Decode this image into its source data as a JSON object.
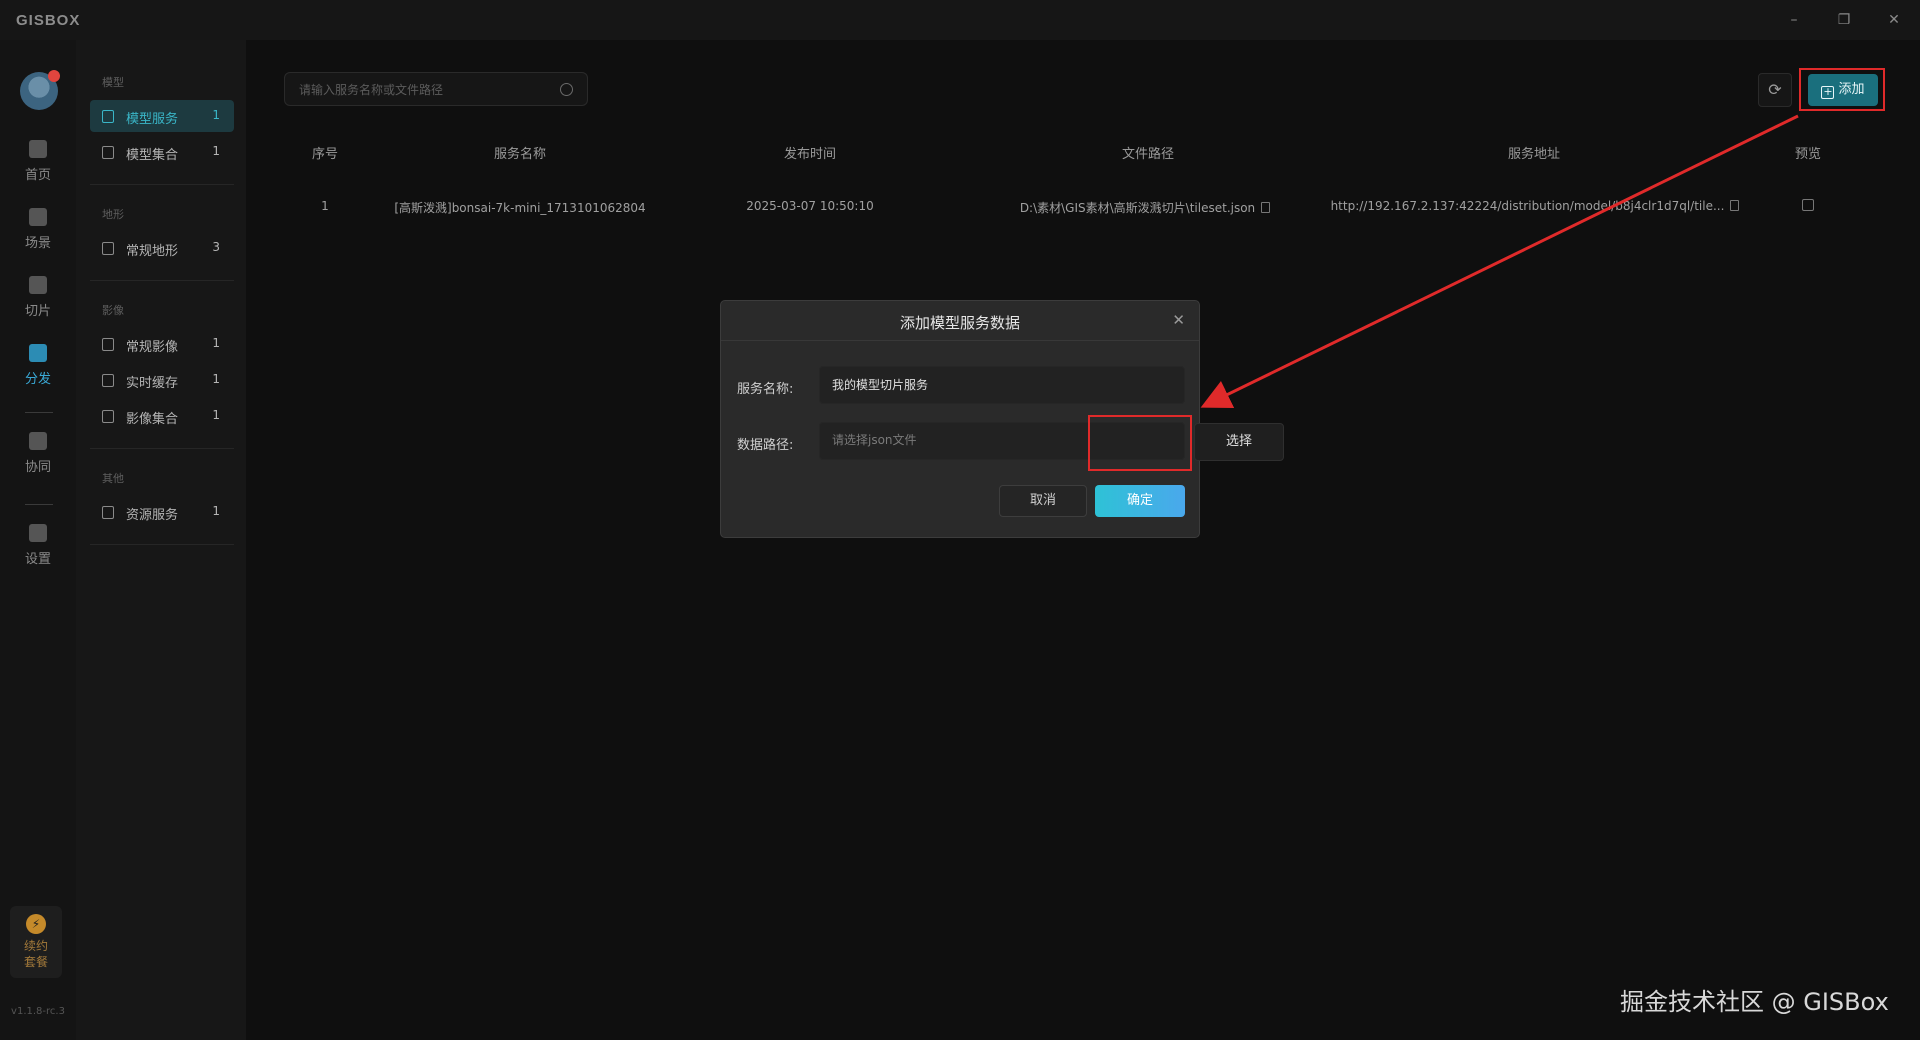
{
  "app": {
    "title": "GISBOX",
    "version": "v1.1.8-rc.3"
  },
  "window_controls": {
    "minimize": "–",
    "restore": "❐",
    "close": "✕"
  },
  "rail": {
    "items": [
      {
        "label": "首页",
        "icon": "home-icon"
      },
      {
        "label": "场景",
        "icon": "scene-icon"
      },
      {
        "label": "切片",
        "icon": "tile-icon"
      },
      {
        "label": "分发",
        "icon": "distribute-icon",
        "active": true
      },
      {
        "label": "协同",
        "icon": "collaborate-icon"
      },
      {
        "label": "设置",
        "icon": "settings-icon"
      }
    ],
    "renew": {
      "line1": "续约",
      "line2": "套餐"
    }
  },
  "sidebar": {
    "groups": [
      {
        "title": "模型",
        "items": [
          {
            "label": "模型服务",
            "count": "1",
            "active": true
          },
          {
            "label": "模型集合",
            "count": "1"
          }
        ]
      },
      {
        "title": "地形",
        "items": [
          {
            "label": "常规地形",
            "count": "3"
          }
        ]
      },
      {
        "title": "影像",
        "items": [
          {
            "label": "常规影像",
            "count": "1"
          },
          {
            "label": "实时缓存",
            "count": "1"
          },
          {
            "label": "影像集合",
            "count": "1"
          }
        ]
      },
      {
        "title": "其他",
        "items": [
          {
            "label": "资源服务",
            "count": "1"
          }
        ]
      }
    ]
  },
  "toolbar": {
    "search_placeholder": "请输入服务名称或文件路径",
    "add_label": "添加"
  },
  "table": {
    "columns": [
      "序号",
      "服务名称",
      "发布时间",
      "文件路径",
      "服务地址",
      "预览"
    ],
    "rows": [
      {
        "index": "1",
        "name": "[高斯泼溅]bonsai-7k-mini_1713101062804",
        "time": "2025-03-07 10:50:10",
        "path": "D:\\素材\\GIS素材\\高斯泼溅切片\\tileset.json",
        "url": "http://192.167.2.137:42224/distribution/model/b8j4clr1d7ql/tile..."
      }
    ]
  },
  "dialog": {
    "title": "添加模型服务数据",
    "name_label": "服务名称:",
    "name_value": "我的模型切片服务",
    "path_label": "数据路径:",
    "path_placeholder": "请选择json文件",
    "choose_label": "选择",
    "cancel_label": "取消",
    "ok_label": "确定"
  },
  "colors": {
    "accent": "#3ab6c8",
    "highlight": "#e02a2a",
    "ok_button": "#2ec2d6"
  },
  "watermark": "掘金技术社区 @ GISBox"
}
